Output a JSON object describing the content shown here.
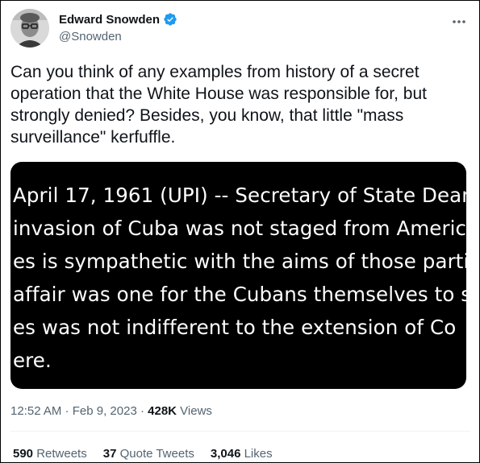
{
  "author": {
    "name": "Edward Snowden",
    "handle": "@Snowden",
    "verified_color": "#1d9bf0"
  },
  "tweet": {
    "text": "Can you think of any examples from history of a secret operation that the White House was responsible for, but strongly denied? Besides, you know, that little \"mass surveillance\" kerfuffle."
  },
  "media": {
    "lines": [
      "April 17, 1961 (UPI) -- Secretary of State Dean",
      "invasion of Cuba was not staged from Americ",
      "es is sympathetic with the aims of those parti",
      "affair was one for the Cubans themselves to s",
      "es was not indifferent to the extension of Co",
      "ere."
    ]
  },
  "meta": {
    "time": "12:52 AM",
    "sep1": " · ",
    "date": "Feb 9, 2023",
    "sep2": " · ",
    "views_count": "428K",
    "views_label": " Views"
  },
  "stats": {
    "retweets_count": "590",
    "retweets_label": " Retweets",
    "quotes_count": "37",
    "quotes_label": " Quote Tweets",
    "likes_count": "3,046",
    "likes_label": " Likes"
  }
}
